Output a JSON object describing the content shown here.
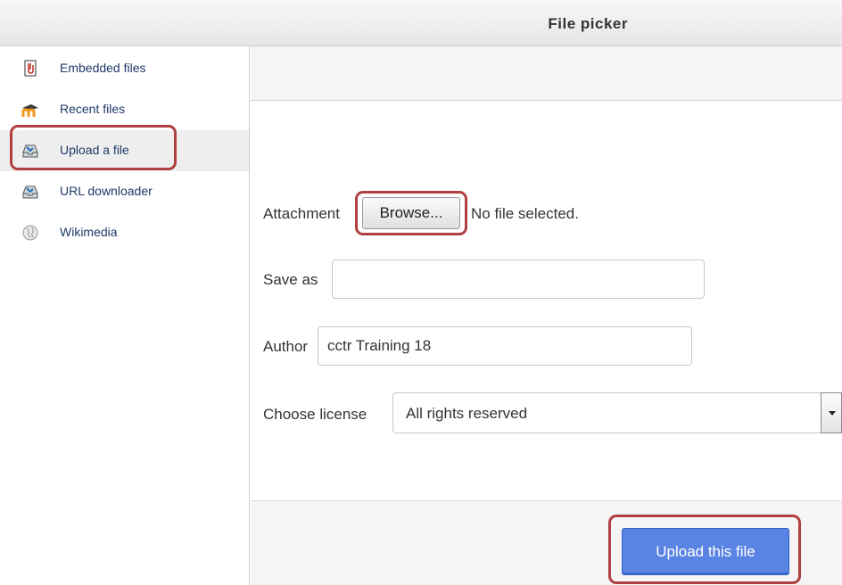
{
  "window": {
    "title": "File picker"
  },
  "sidebar": {
    "items": [
      {
        "label": "Embedded files",
        "icon": "embedded-files-icon",
        "active": false
      },
      {
        "label": "Recent files",
        "icon": "moodle-icon",
        "active": false
      },
      {
        "label": "Upload a file",
        "icon": "upload-icon",
        "active": true
      },
      {
        "label": "URL downloader",
        "icon": "url-downloader-icon",
        "active": false
      },
      {
        "label": "Wikimedia",
        "icon": "wikimedia-icon",
        "active": false
      }
    ]
  },
  "form": {
    "attachment_label": "Attachment",
    "browse_label": "Browse...",
    "no_file_text": "No file selected.",
    "save_as_label": "Save as",
    "save_as_value": "",
    "author_label": "Author",
    "author_value": "cctr Training 18",
    "license_label": "Choose license",
    "license_value": "All rights reserved",
    "upload_button_label": "Upload this file"
  },
  "colors": {
    "highlight_border": "#b04040",
    "primary_button": "#5a84e3",
    "sidebar_link": "#1f3a68"
  }
}
